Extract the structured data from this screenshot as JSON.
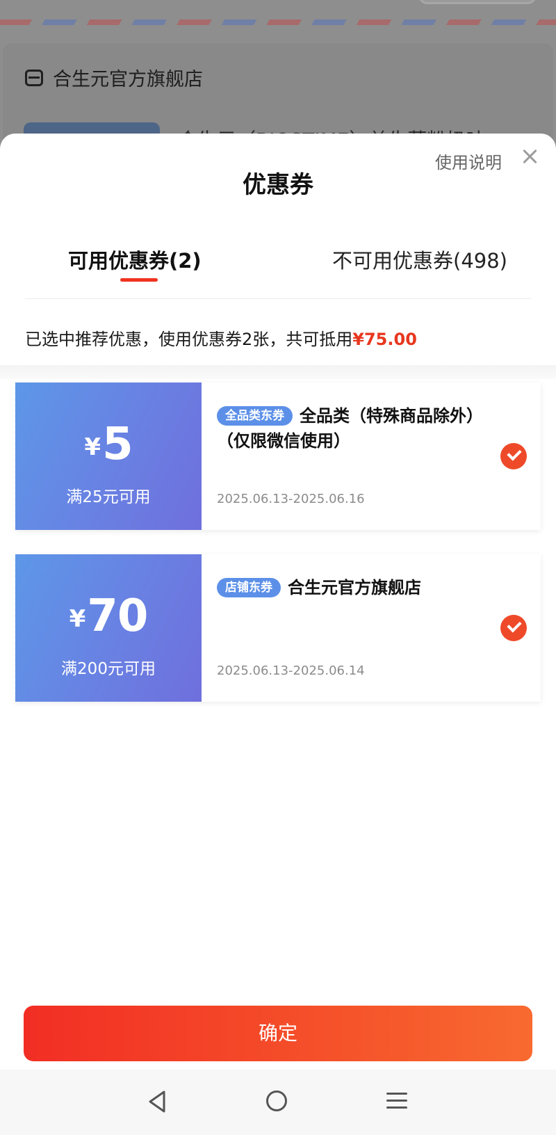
{
  "background": {
    "store_name": "合生元官方旗舰店",
    "product_title": "合生元（BIOSTIME）益生菌粉奶味",
    "icons": {
      "store": "store-icon"
    }
  },
  "sheet": {
    "title": "优惠券",
    "help_label": "使用说明",
    "close_icon": "close-icon"
  },
  "tabs": {
    "available_label": "可用优惠券(2)",
    "unavailable_label": "不可用优惠券(498)"
  },
  "summary": {
    "text": "已选中推荐优惠，使用优惠券2张，共可抵用",
    "amount": "¥75.00"
  },
  "coupons": [
    {
      "currency": "¥",
      "amount": "5",
      "threshold": "满25元可用",
      "tag": "全品类东券",
      "description": "全品类（特殊商品除外）（仅限微信使用）",
      "validity": "2025.06.13-2025.06.16",
      "selected": true
    },
    {
      "currency": "¥",
      "amount": "70",
      "threshold": "满200元可用",
      "tag": "店铺东券",
      "description": "合生元官方旗舰店",
      "validity": "2025.06.13-2025.06.14",
      "selected": true
    }
  ],
  "confirm_label": "确定",
  "nav": {
    "back": "back-icon",
    "home": "home-icon",
    "menu": "menu-icon"
  },
  "colors": {
    "accent": "#f0331f",
    "coupon_gradient_start": "#5d97e8",
    "coupon_gradient_end": "#6f6fdd",
    "tag": "#5c90e8",
    "check": "#ee4a2a"
  }
}
